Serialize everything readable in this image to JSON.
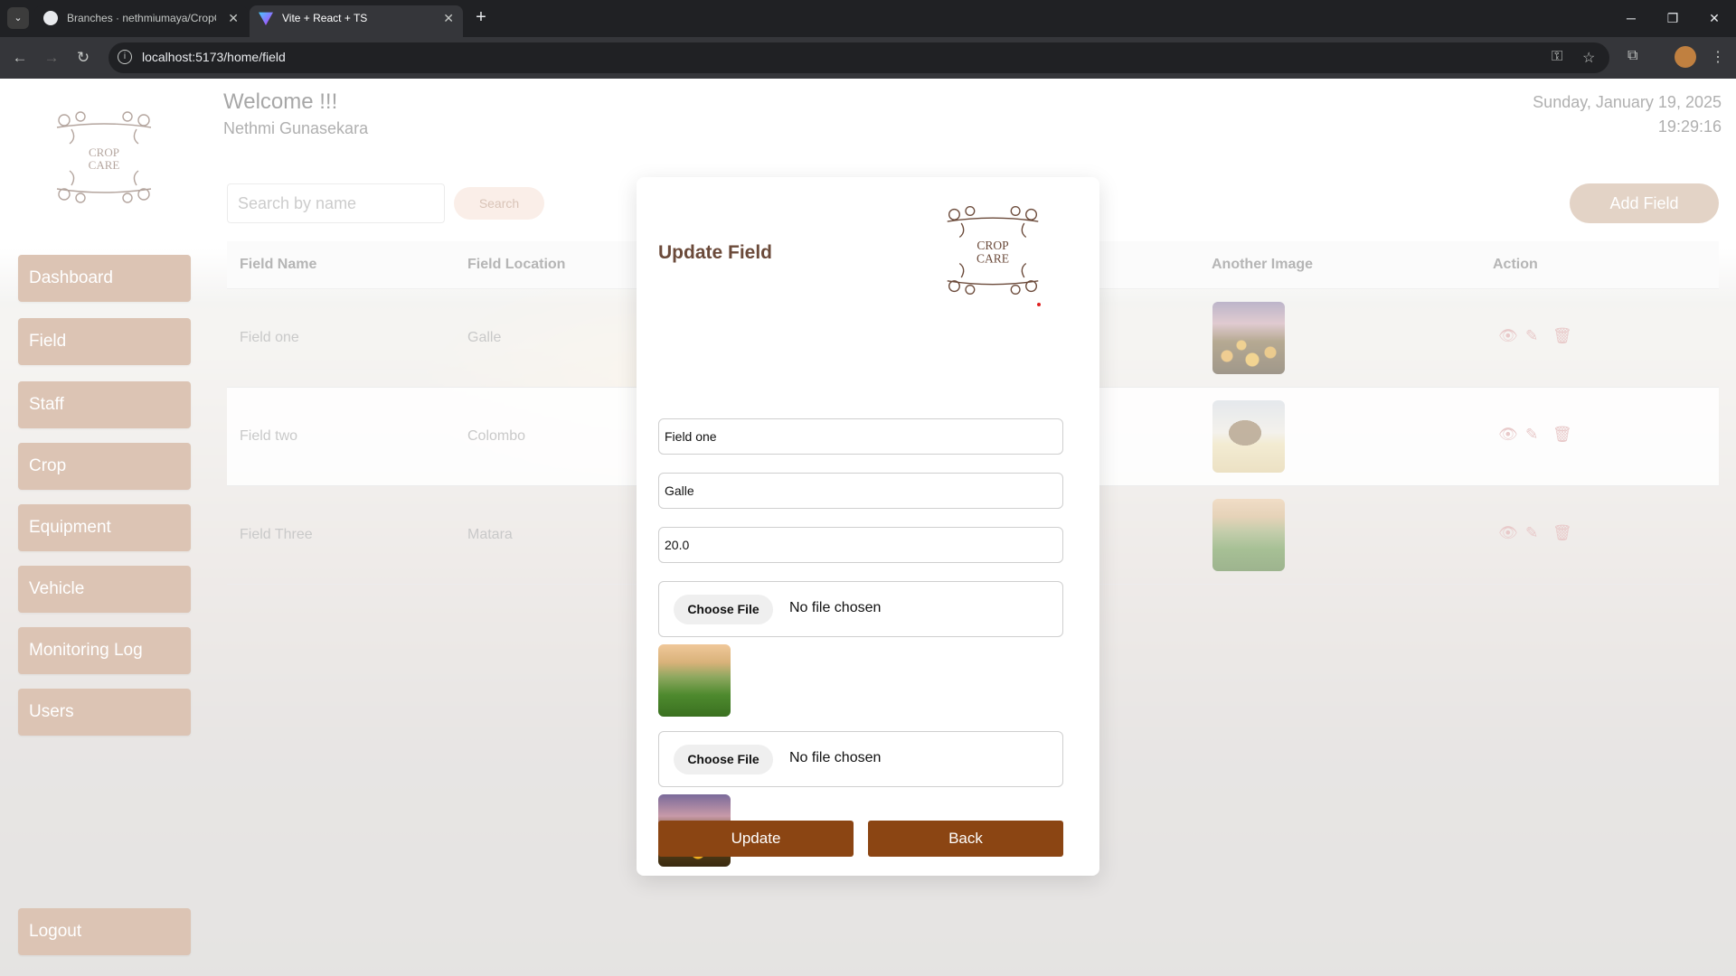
{
  "browser": {
    "tabs": [
      {
        "title": "Branches · nethmiumaya/CropC",
        "active": false
      },
      {
        "title": "Vite + React + TS",
        "active": true
      }
    ],
    "url": "localhost:5173/home/field"
  },
  "header": {
    "welcome": "Welcome !!!",
    "user_name": "Nethmi Gunasekara",
    "date": "Sunday, January 19, 2025",
    "time": "19:29:16"
  },
  "logo": {
    "line1": "CROP",
    "line2": "CARE"
  },
  "sidebar": {
    "items": [
      {
        "label": "Dashboard"
      },
      {
        "label": "Field"
      },
      {
        "label": "Staff"
      },
      {
        "label": "Crop"
      },
      {
        "label": "Equipment"
      },
      {
        "label": "Vehicle"
      },
      {
        "label": "Monitoring Log"
      },
      {
        "label": "Users"
      }
    ],
    "logout": "Logout"
  },
  "toolbar": {
    "search_placeholder": "Search by name",
    "search_label": "Search",
    "add_label": "Add Field"
  },
  "table": {
    "columns": [
      "Field Name",
      "Field Location",
      "Another Image",
      "Action"
    ],
    "rows": [
      {
        "name": "Field one",
        "location": "Galle"
      },
      {
        "name": "Field two",
        "location": "Colombo"
      },
      {
        "name": "Field Three",
        "location": "Matara"
      }
    ]
  },
  "modal": {
    "title": "Update Field",
    "field_name": "Field one",
    "field_location": "Galle",
    "field_size": "20.0",
    "choose_file_label": "Choose File",
    "no_file_label": "No file chosen",
    "update_label": "Update",
    "back_label": "Back"
  },
  "colors": {
    "accent_brown": "#8b4513",
    "sidebar_button": "#dcc4b4",
    "title_brown": "#6b4a3a"
  }
}
